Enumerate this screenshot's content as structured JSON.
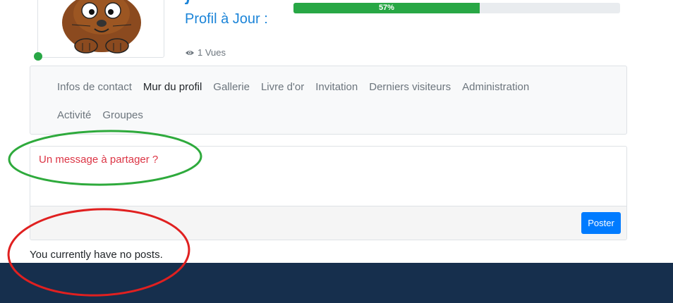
{
  "profile": {
    "update_label": "Profil à Jour :",
    "progress_percent": 57,
    "progress_text": "57%",
    "views_text": "1 Vues",
    "online": true
  },
  "nav": {
    "items": [
      {
        "label": "Infos de contact",
        "active": false
      },
      {
        "label": "Mur du profil",
        "active": true
      },
      {
        "label": "Gallerie",
        "active": false
      },
      {
        "label": "Livre d'or",
        "active": false
      },
      {
        "label": "Invitation",
        "active": false
      },
      {
        "label": "Derniers visiteurs",
        "active": false
      },
      {
        "label": "Administration",
        "active": false
      },
      {
        "label": "Activité",
        "active": false
      },
      {
        "label": "Groupes",
        "active": false
      }
    ]
  },
  "post_form": {
    "placeholder": "Un message à partager ?",
    "submit_label": "Poster"
  },
  "wall": {
    "empty_message": "You currently have no posts."
  },
  "colors": {
    "accent_blue": "#1b84d8",
    "progress_green": "#28a745",
    "button_blue": "#007bff",
    "placeholder_red": "#dc3545",
    "footer_navy": "#162f4d",
    "annotation_green": "#2eaa3c",
    "annotation_red": "#e02020"
  }
}
